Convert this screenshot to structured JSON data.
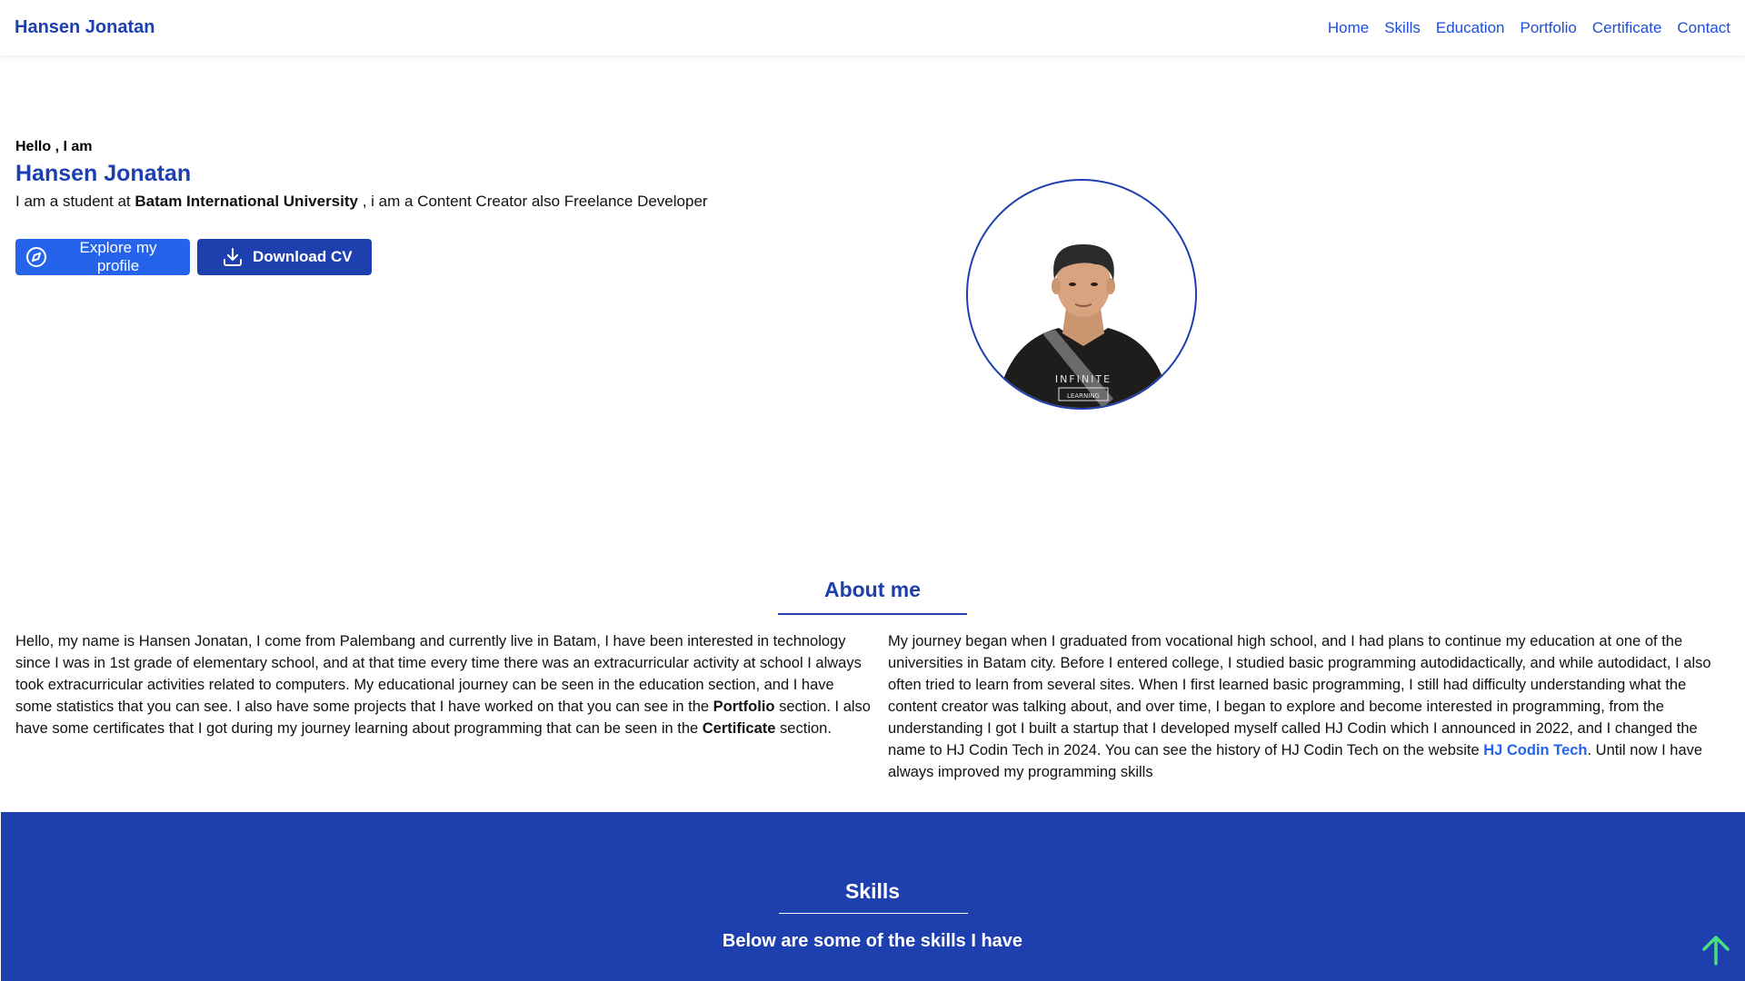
{
  "nav": {
    "brand": "Hansen Jonatan",
    "links": [
      "Home",
      "Skills",
      "Education",
      "Portfolio",
      "Certificate",
      "Contact"
    ]
  },
  "hero": {
    "greeting": "Hello , I am",
    "name": "Hansen Jonatan",
    "desc_prefix": "I am a student at ",
    "university": "Batam International University",
    "desc_suffix": " , i am a Content Creator also Freelance Developer",
    "explore_label": "Explore my profile",
    "download_label": "Download CV",
    "shirt_text_1": "INFINITE",
    "shirt_text_2": "LEARNING"
  },
  "about": {
    "title": "About me",
    "left_part1": "Hello, my name is Hansen Jonatan, I come from Palembang and currently live in Batam, I have been interested in technology since I was in 1st grade of elementary school, and at that time every time there was an extracurricular activity at school I always took extracurricular activities related to computers. My educational journey can be seen in the education section, and I have some statistics that you can see. I also have some projects that I have worked on that you can see in the ",
    "left_bold1": "Portfolio",
    "left_part2": " section. I also have some certificates that I got during my journey learning about programming that can be seen in the ",
    "left_bold2": "Certificate",
    "left_part3": " section.",
    "right_part1": "My journey began when I graduated from vocational high school, and I had plans to continue my education at one of the universities in Batam city. Before I entered college, I studied basic programming autodidactically, and while autodidact, I also often tried to learn from several sites. When I first learned basic programming, I still had difficulty understanding what the content creator was talking about, and over time, I began to explore and become interested in programming, from the understanding I got I built a startup that I developed myself called HJ Codin which I announced in 2022, and I changed the name to HJ Codin Tech in 2024. You can see the history of HJ Codin Tech on the website ",
    "right_link": "HJ Codin Tech",
    "right_part2": ". Until now I have always improved my programming skills"
  },
  "skills": {
    "title": "Skills",
    "subtitle": "Below are some of the skills I have"
  },
  "colors": {
    "primary": "#1e40af",
    "accent": "#2563eb",
    "scroll_top": "#4ade80"
  },
  "icons": {
    "explore": "compass-icon",
    "download": "download-icon",
    "scroll_top": "arrow-up-icon"
  }
}
